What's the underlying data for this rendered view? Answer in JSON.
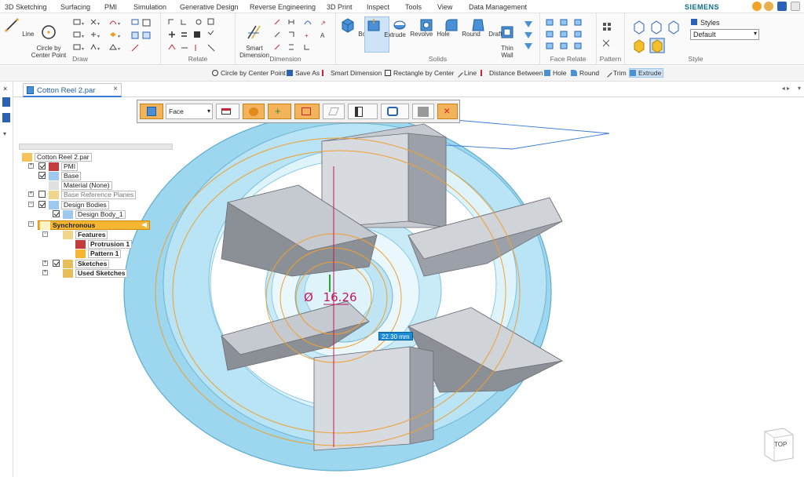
{
  "menu": {
    "items": [
      "3D Sketching",
      "Surfacing",
      "PMI",
      "Simulation",
      "Generative Design",
      "Reverse Engineering",
      "3D Print",
      "Inspect",
      "Tools",
      "View",
      "Data Management"
    ],
    "brand": "SIEMENS"
  },
  "ribbon": {
    "draw": {
      "line": "Line",
      "circle": "Circle by\nCenter Point",
      "label": "Draw"
    },
    "relate": {
      "label": "Relate"
    },
    "dimension": {
      "smart": "Smart\nDimension",
      "label": "Dimension"
    },
    "solids": {
      "buttons": [
        "Box",
        "Extrude",
        "Revolve",
        "Hole",
        "Round",
        "Draft",
        "Thin\nWall"
      ],
      "label": "Solids"
    },
    "face_relate": {
      "label": "Face Relate"
    },
    "pattern": {
      "label": "Pattern"
    },
    "style": {
      "styles_label": "Styles",
      "styles_value": "Default",
      "label": "Style"
    }
  },
  "quickbar": {
    "items": [
      "Circle by Center Point",
      "Save As",
      "Smart Dimension",
      "Rectangle by Center",
      "Line",
      "Distance Between",
      "Hole",
      "Round",
      "Trim",
      "Extrude"
    ]
  },
  "document": {
    "tab": "Cotton Reel 2.par"
  },
  "command_bar": {
    "select_value": "Face"
  },
  "tree": {
    "root": "Cotton Reel 2.par",
    "pmi": "PMI",
    "base": "Base",
    "material": "Material (None)",
    "ref_planes": "Base Reference Planes",
    "design_bodies": "Design Bodies",
    "design_body": "Design Body_1",
    "synchronous": "Synchronous",
    "features": "Features",
    "protrusion": "Protrusion 1",
    "pattern": "Pattern 1",
    "sketches": "Sketches",
    "used_sketches": "Used Sketches"
  },
  "viewport": {
    "dimension_value": "22.30 mm",
    "diameter_symbol": "Ø",
    "diameter_text": "16.26"
  },
  "navcube": {
    "label": "TOP"
  },
  "colors": {
    "accent": "#1d5fb4",
    "selection": "#cfe3f7",
    "part": "#a8dcf2",
    "sketch": "#f0a030",
    "dimension": "#c2185b"
  }
}
